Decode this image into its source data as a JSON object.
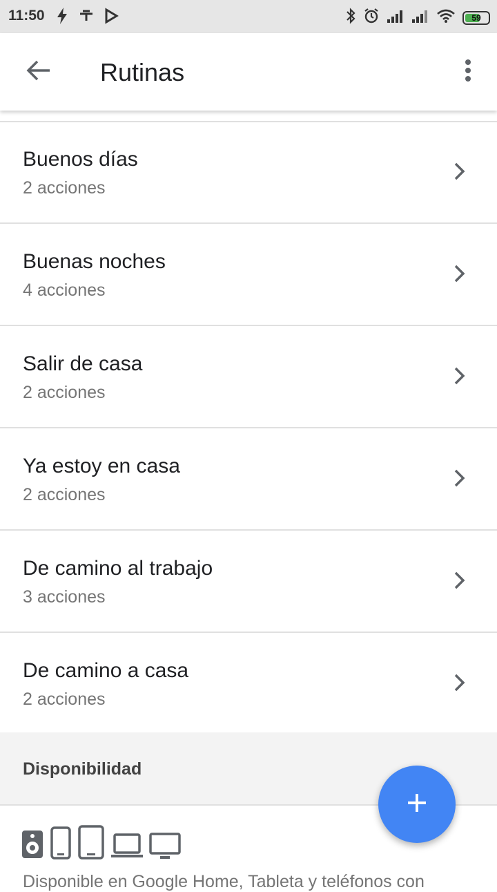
{
  "status_bar": {
    "time": "11:50",
    "battery": "59",
    "icons": [
      "flash-icon",
      "tt-icon",
      "play-store-icon",
      "bluetooth-icon",
      "alarm-icon",
      "signal-icon",
      "signal-icon",
      "wifi-icon",
      "battery-icon"
    ]
  },
  "appbar": {
    "title": "Rutinas",
    "back_icon": "arrow-back-icon",
    "menu_icon": "more-vert-icon"
  },
  "routines": [
    {
      "title": "Buenos días",
      "subtitle": "2 acciones"
    },
    {
      "title": "Buenas noches",
      "subtitle": "4 acciones"
    },
    {
      "title": "Salir de casa",
      "subtitle": "2 acciones"
    },
    {
      "title": "Ya estoy en casa",
      "subtitle": "2 acciones"
    },
    {
      "title": "De camino al trabajo",
      "subtitle": "3 acciones"
    },
    {
      "title": "De camino a casa",
      "subtitle": "2 acciones"
    }
  ],
  "availability": {
    "header": "Disponibilidad",
    "device_icons": [
      "speaker-icon",
      "phone-icon",
      "tablet-icon",
      "laptop-icon",
      "monitor-icon"
    ],
    "description": "Disponible en Google Home, Tableta y teléfonos con"
  },
  "fab": {
    "icon": "plus-icon"
  },
  "colors": {
    "accent": "#4285f4",
    "text_primary": "#202124",
    "text_secondary": "#757575"
  }
}
